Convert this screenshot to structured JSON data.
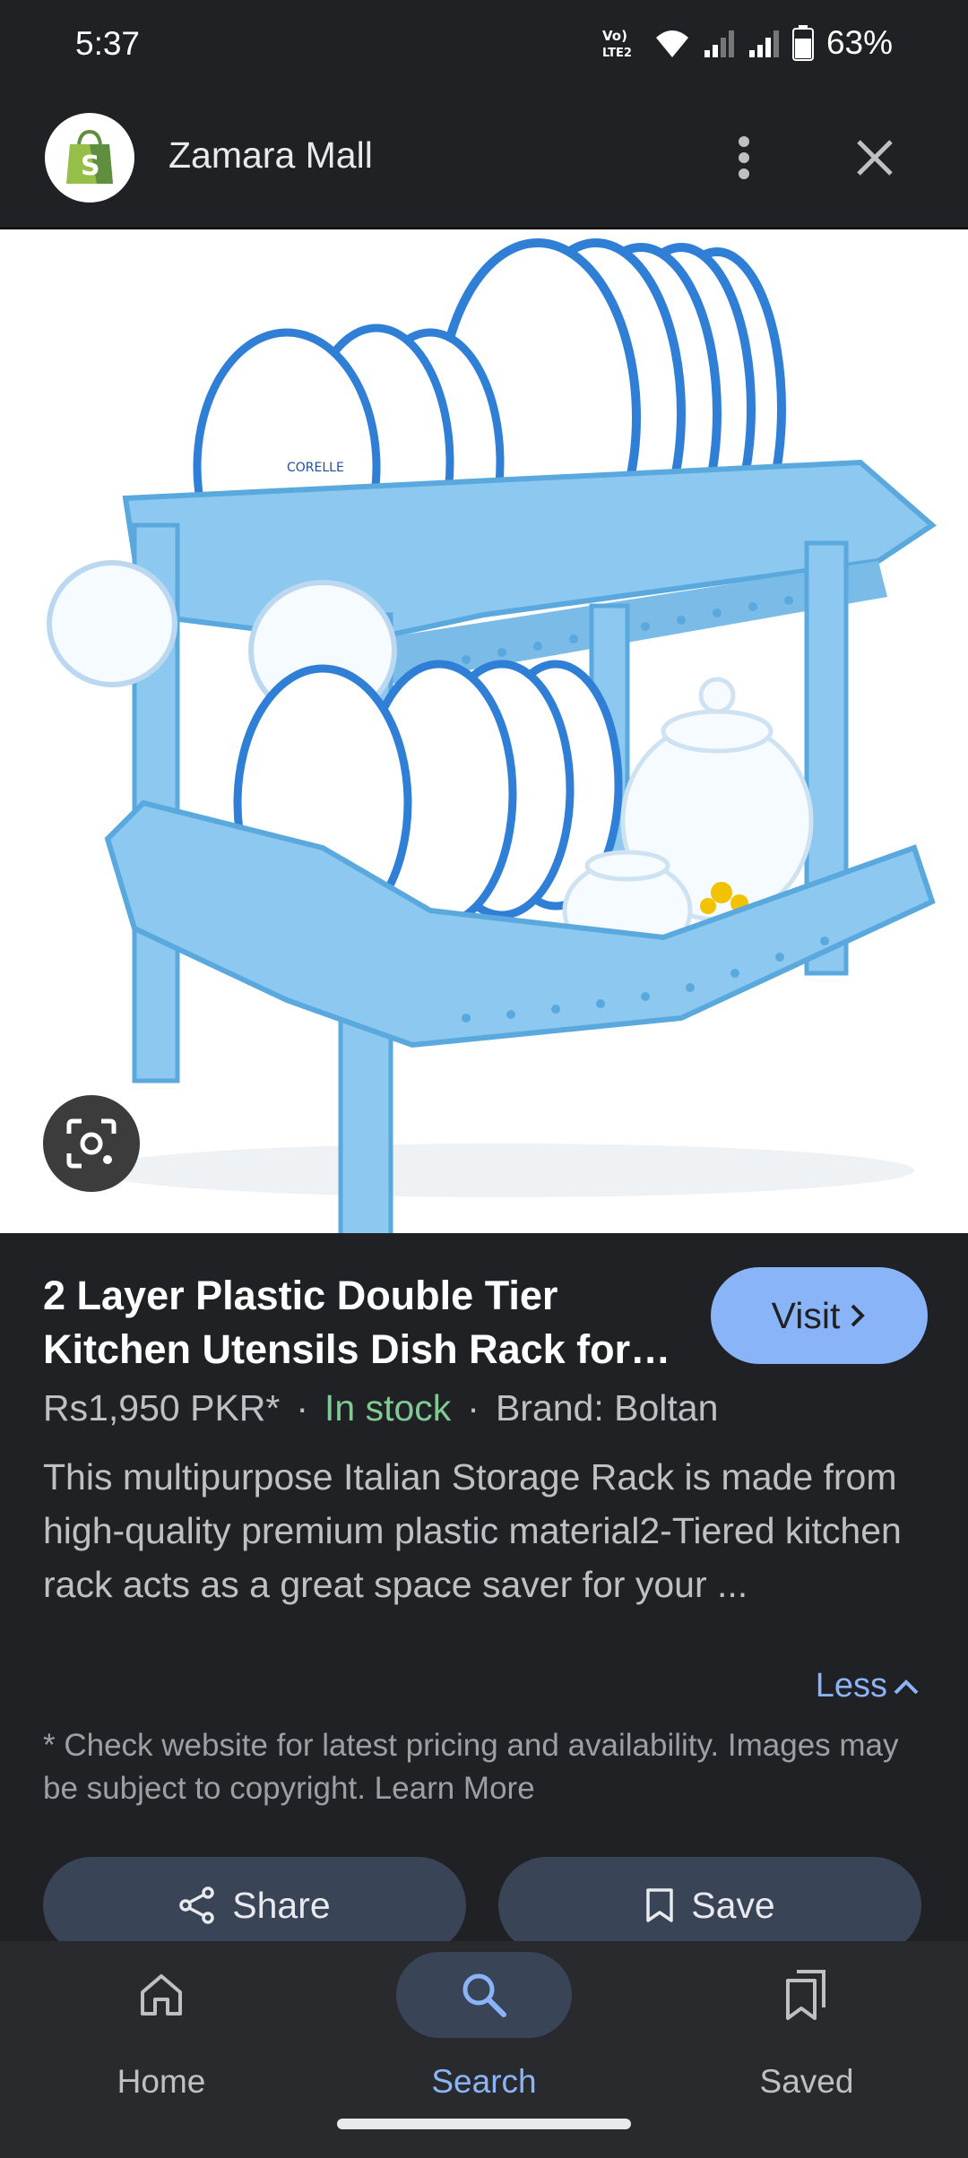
{
  "status_bar": {
    "time": "5:37",
    "network_label": "Vo) LTE2",
    "battery": "63%"
  },
  "header": {
    "site_name": "Zamara Mall",
    "logo_icon": "shopify-bag-icon",
    "more_icon": "more-vert-icon",
    "close_icon": "close-icon"
  },
  "product": {
    "title": "2 Layer Plastic Double Tier Kitchen Utensils Dish Rack for…",
    "visit_label": "Visit",
    "price": "Rs1,950 PKR*",
    "stock": "In stock",
    "brand": "Brand: Boltan",
    "description": "This multipurpose Italian Storage Rack is made from high-quality premium plastic material2-Tiered kitchen rack acts as a great space saver for your ...",
    "less_label": "Less",
    "disclaimer": "* Check website for latest pricing and availability. Images may be subject to copyright.",
    "learn_more": "Learn More",
    "plate_label": "CORELLE"
  },
  "actions": {
    "share_label": "Share",
    "save_label": "Save"
  },
  "nav": [
    {
      "label": "Home",
      "icon": "home-icon"
    },
    {
      "label": "Search",
      "icon": "search-icon",
      "active": true
    },
    {
      "label": "Saved",
      "icon": "saved-icon"
    }
  ],
  "colors": {
    "accent": "#8ab4f8",
    "in_stock": "#81c995",
    "rack_blue": "#8cc8f0",
    "background": "#202124"
  }
}
